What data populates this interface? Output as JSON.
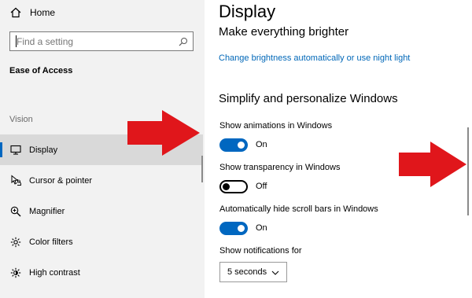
{
  "sidebar": {
    "home_label": "Home",
    "search_placeholder": "Find a setting",
    "section_title": "Ease of Access",
    "group_label": "Vision",
    "items": [
      {
        "label": "Display",
        "icon": "monitor-icon",
        "active": true
      },
      {
        "label": "Cursor & pointer",
        "icon": "cursor-pointer-icon",
        "active": false
      },
      {
        "label": "Magnifier",
        "icon": "magnifier-icon",
        "active": false
      },
      {
        "label": "Color filters",
        "icon": "color-filters-icon",
        "active": false
      },
      {
        "label": "High contrast",
        "icon": "high-contrast-icon",
        "active": false
      }
    ]
  },
  "main": {
    "title": "Display",
    "subtitle": "Make everything brighter",
    "brightness_link": "Change brightness automatically or use night light",
    "section_heading": "Simplify and personalize Windows",
    "settings": [
      {
        "label": "Show animations in Windows",
        "state": "On",
        "on": true
      },
      {
        "label": "Show transparency in Windows",
        "state": "Off",
        "on": false
      },
      {
        "label": "Automatically hide scroll bars in Windows",
        "state": "On",
        "on": true
      }
    ],
    "notifications": {
      "label": "Show notifications for",
      "selected": "5 seconds"
    }
  },
  "colors": {
    "accent": "#0067c0",
    "link": "#0067b8",
    "sidebar_bg": "#f2f2f2",
    "active_item_bg": "#d9d9d9",
    "arrow_red": "#e0161b"
  }
}
